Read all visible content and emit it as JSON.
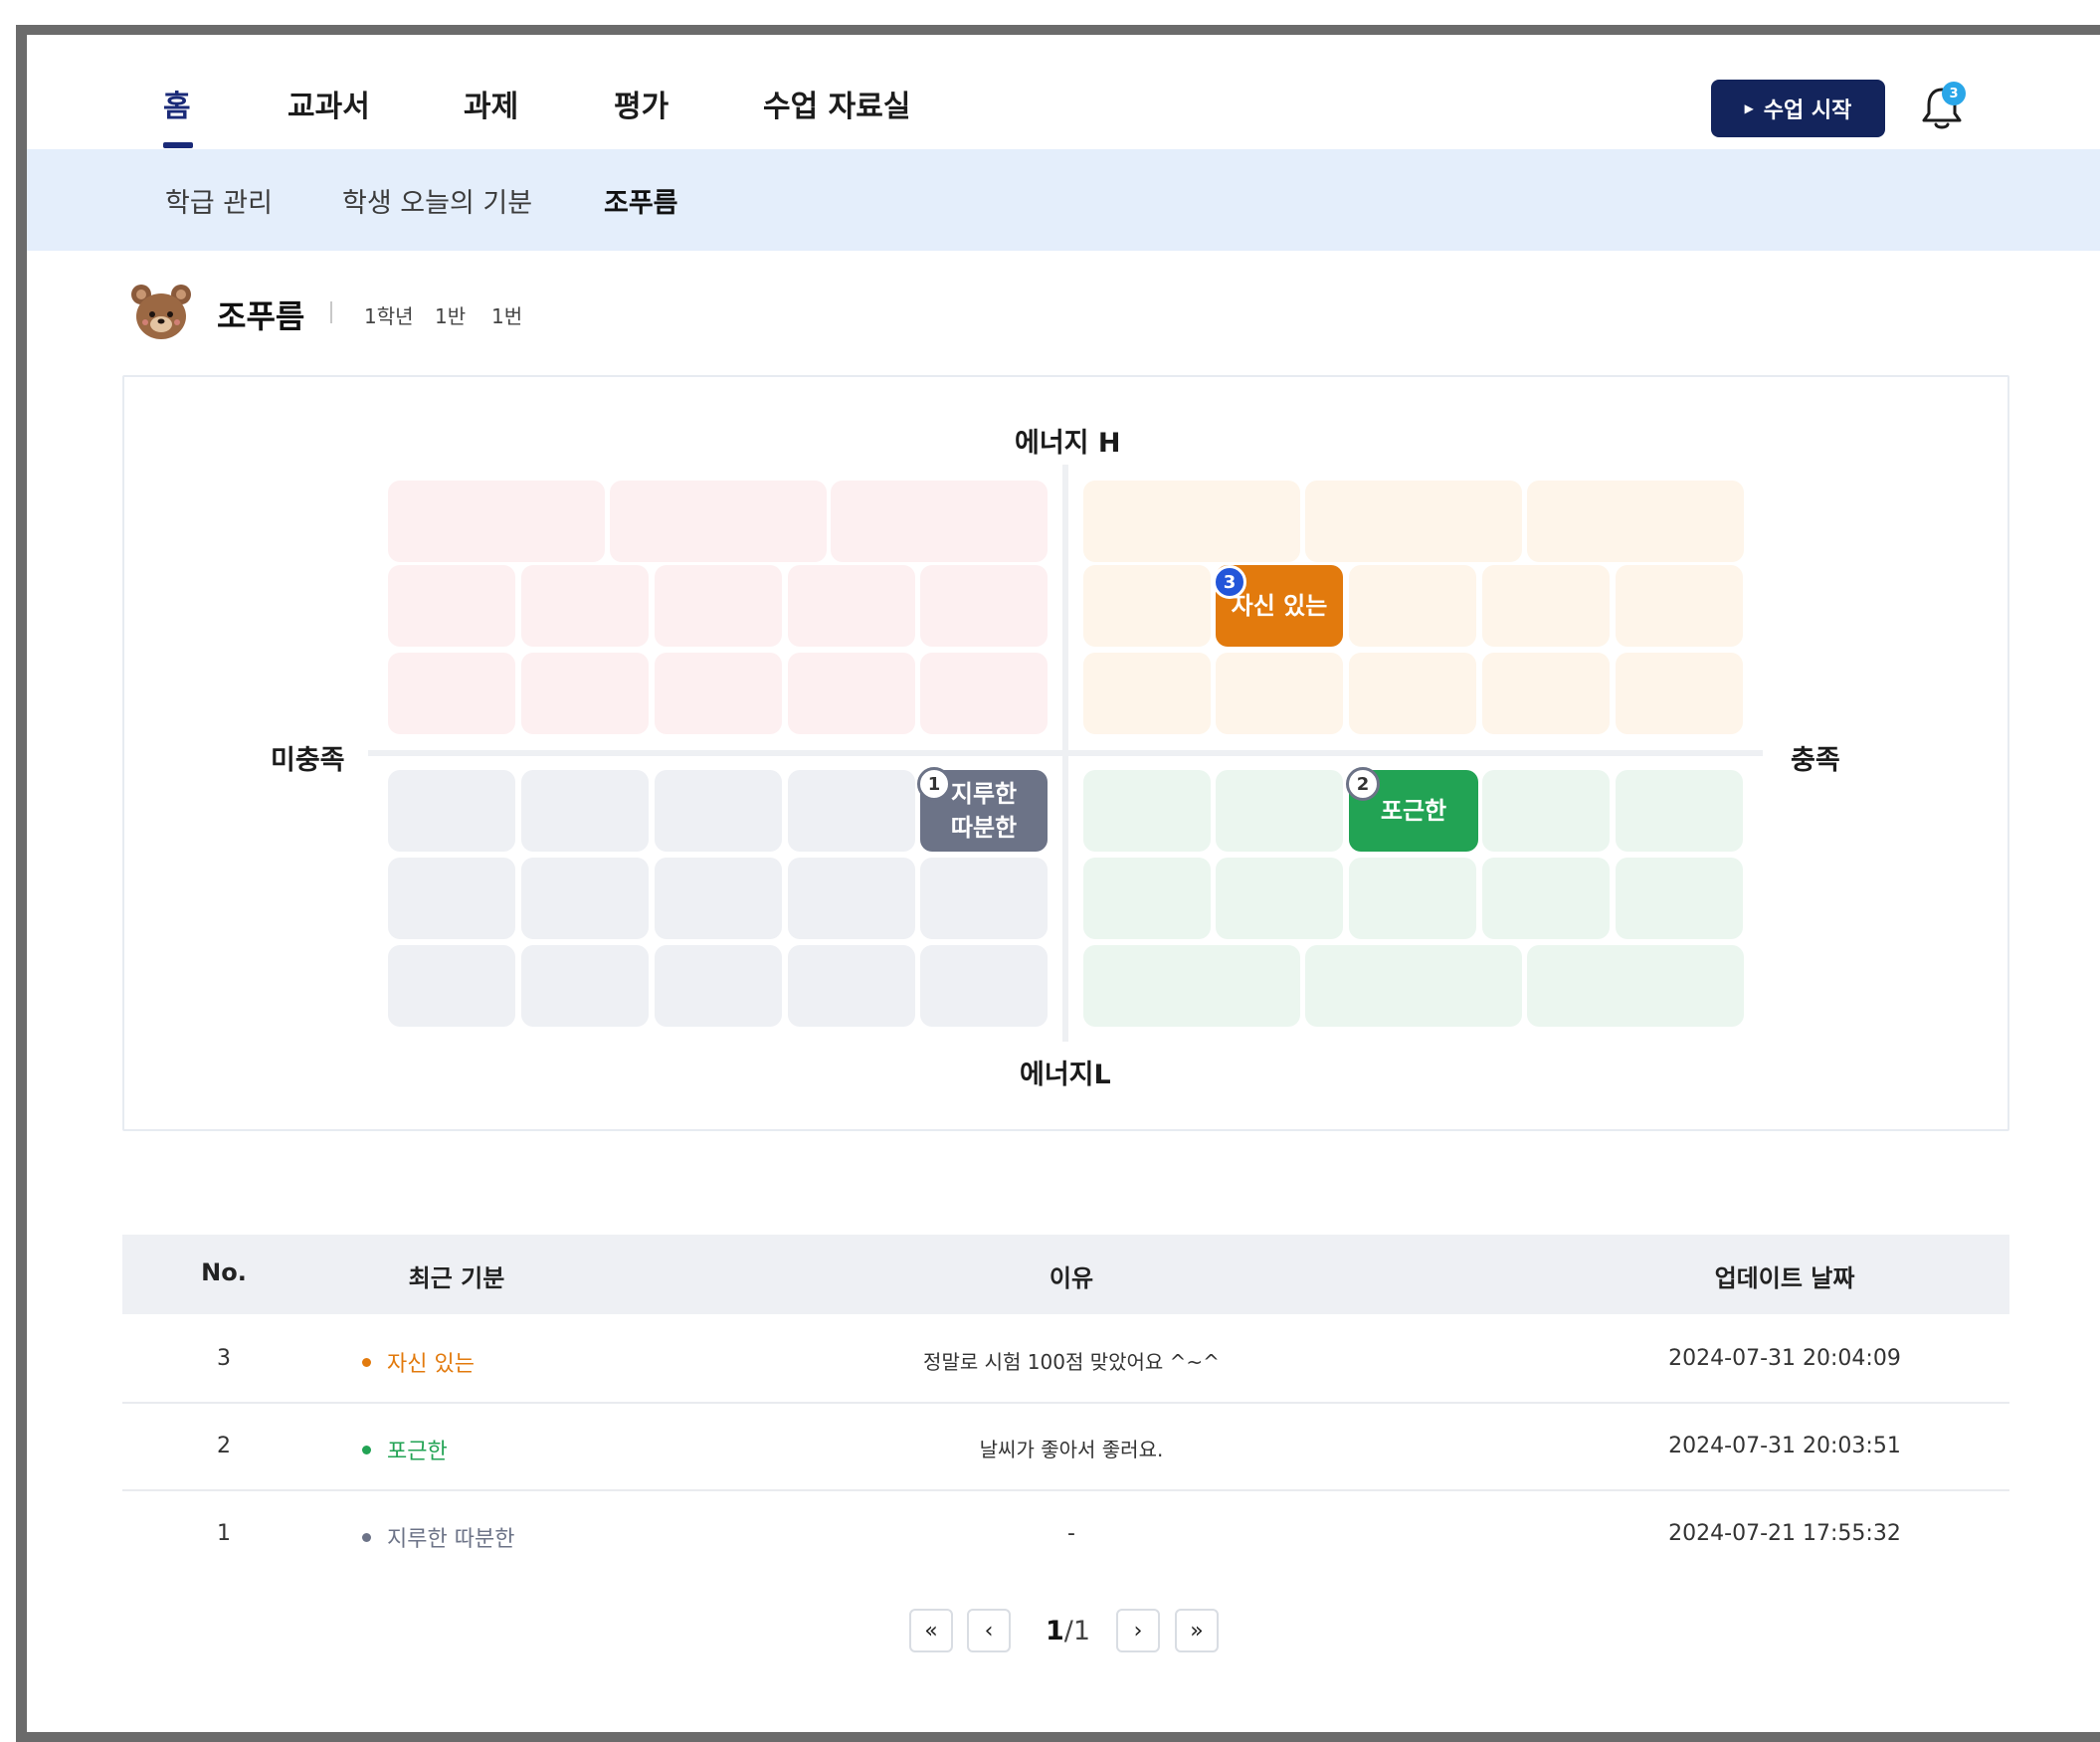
{
  "nav": {
    "tabs": [
      {
        "label": "홈",
        "active": true
      },
      {
        "label": "교과서"
      },
      {
        "label": "과제"
      },
      {
        "label": "평가"
      },
      {
        "label": "수업 자료실"
      }
    ],
    "start_button_label": "수업 시작",
    "notification_count": "3"
  },
  "subnav": {
    "tabs": [
      {
        "label": "학급 관리"
      },
      {
        "label": "학생 오늘의 기분"
      },
      {
        "label": "조푸름",
        "active": true
      }
    ]
  },
  "student": {
    "name": "조푸름",
    "grade": "1학년",
    "class": "1반",
    "number": "1번"
  },
  "mood_map": {
    "axis_top": "에너지 H",
    "axis_bottom": "에너지L",
    "axis_left": "미충족",
    "axis_right": "충족",
    "quadrant_colors": {
      "top_left": "#fdf0f1",
      "top_right": "#fef5ea",
      "bottom_left": "#eef0f4",
      "bottom_right": "#ebf6ef"
    },
    "entries": [
      {
        "no": "3",
        "label": "자신 있는",
        "color": "#e27a0d"
      },
      {
        "no": "1",
        "label_line1": "지루한",
        "label_line2": "따분한",
        "color": "#6c7387"
      },
      {
        "no": "2",
        "label": "포근한",
        "color": "#22a354"
      }
    ]
  },
  "table": {
    "headers": [
      "No.",
      "최근 기분",
      "이유",
      "업데이트 날짜"
    ],
    "rows": [
      {
        "no": "3",
        "mood": "자신 있는",
        "mood_color": "#e27a0d",
        "reason": "정말로 시험 100점 맞았어요 ^~^",
        "date": "2024-07-31 20:04:09"
      },
      {
        "no": "2",
        "mood": "포근한",
        "mood_color": "#22a354",
        "reason": "날씨가 좋아서 좋러요.",
        "date": "2024-07-31 20:03:51"
      },
      {
        "no": "1",
        "mood": "지루한 따분한",
        "mood_color": "#6c7387",
        "reason": "-",
        "date": "2024-07-21 17:55:32"
      }
    ]
  },
  "pagination": {
    "current": "1",
    "total": "/1",
    "first_icon": "double-chevron-left-icon",
    "prev_icon": "chevron-left-icon",
    "next_icon": "chevron-right-icon",
    "last_icon": "double-chevron-right-icon"
  }
}
